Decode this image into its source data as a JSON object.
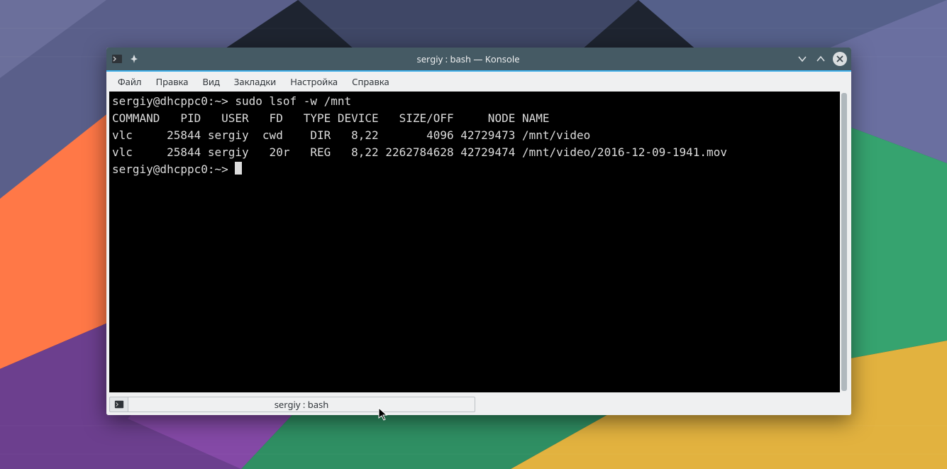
{
  "window": {
    "title": "sergiy : bash — Konsole"
  },
  "menubar": {
    "items": [
      "Файл",
      "Правка",
      "Вид",
      "Закладки",
      "Настройка",
      "Справка"
    ]
  },
  "terminal": {
    "prompt1": "sergiy@dhcppc0:~> ",
    "command1": "sudo lsof -w /mnt",
    "header": "COMMAND   PID   USER   FD   TYPE DEVICE   SIZE/OFF     NODE NAME",
    "row1": "vlc     25844 sergiy  cwd    DIR   8,22       4096 42729473 /mnt/video",
    "row2": "vlc     25844 sergiy   20r   REG   8,22 2262784628 42729474 /mnt/video/2016-12-09-1941.mov",
    "prompt2": "sergiy@dhcppc0:~> "
  },
  "tab": {
    "label": "sergiy : bash"
  }
}
